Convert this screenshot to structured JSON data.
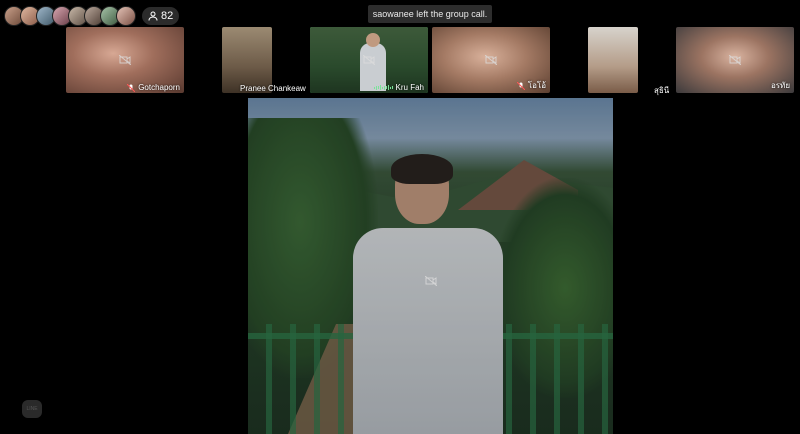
{
  "participants_bar": {
    "avatar_count": 8,
    "participant_count": "82"
  },
  "toast": {
    "message": "saowanee left the group call."
  },
  "tiles": [
    {
      "name": "Gotchaporn",
      "muted": true
    },
    {
      "name": "Pranee Chankeaw",
      "muted": false
    },
    {
      "name": "Kru Fah",
      "muted": false,
      "speaking": true
    },
    {
      "name": "โอโอ้",
      "muted": true
    },
    {
      "name": "สุธินี",
      "muted": false
    },
    {
      "name": "อรทัย",
      "muted": false
    }
  ],
  "colors": {
    "active_border": "#3cc46c",
    "background": "#000000"
  },
  "icons": [
    "participants-icon",
    "mic-off-icon",
    "camera-off-icon",
    "line-logo-icon"
  ]
}
